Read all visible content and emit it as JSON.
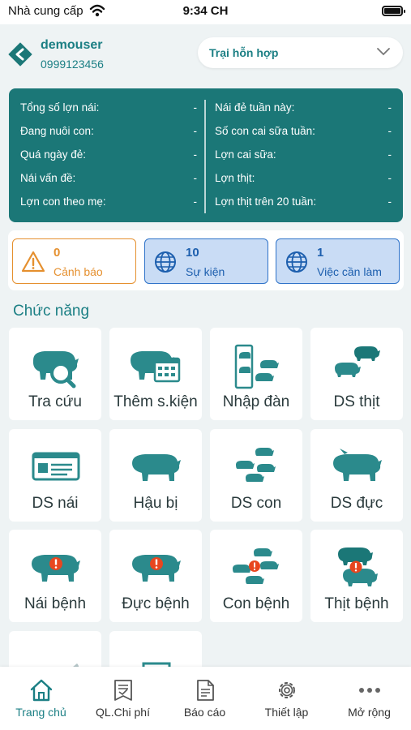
{
  "status_bar": {
    "carrier": "Nhà cung cấp",
    "time": "9:34 CH"
  },
  "header": {
    "username": "demouser",
    "phone": "0999123456",
    "farm": "Trại hỗn hợp"
  },
  "stats": {
    "left": [
      {
        "label": "Tổng số lợn nái:",
        "value": "-"
      },
      {
        "label": "Đang nuôi con:",
        "value": "-"
      },
      {
        "label": "Quá ngày đẻ:",
        "value": "-"
      },
      {
        "label": "Nái vấn đề:",
        "value": "-"
      },
      {
        "label": "Lợn con theo mẹ:",
        "value": "-"
      }
    ],
    "right": [
      {
        "label": "Nái đẻ tuần này:",
        "value": "-"
      },
      {
        "label": "Số con cai sữa tuần:",
        "value": "-"
      },
      {
        "label": "Lợn cai sữa:",
        "value": "-"
      },
      {
        "label": "Lợn thịt:",
        "value": "-"
      },
      {
        "label": "Lợn thịt trên 20 tuần:",
        "value": "-"
      }
    ]
  },
  "summary": {
    "warning": {
      "count": "0",
      "label": "Cảnh báo"
    },
    "events": {
      "count": "10",
      "label": "Sự kiện"
    },
    "todo": {
      "count": "1",
      "label": "Việc cần làm"
    }
  },
  "section_title": "Chức năng",
  "functions": [
    {
      "label": "Tra cứu",
      "icon": "pig-search-icon"
    },
    {
      "label": "Thêm s.kiện",
      "icon": "pig-calendar-icon"
    },
    {
      "label": "Nhập đàn",
      "icon": "pig-import-icon"
    },
    {
      "label": "DS thịt",
      "icon": "pig-group-icon"
    },
    {
      "label": "DS nái",
      "icon": "sow-card-icon"
    },
    {
      "label": "Hậu bị",
      "icon": "gilt-icon"
    },
    {
      "label": "DS con",
      "icon": "piglets-icon"
    },
    {
      "label": "DS đực",
      "icon": "boar-icon"
    },
    {
      "label": "Nái bệnh",
      "icon": "sick-sow-icon"
    },
    {
      "label": "Đực bệnh",
      "icon": "sick-boar-icon"
    },
    {
      "label": "Con bệnh",
      "icon": "sick-piglet-icon"
    },
    {
      "label": "Thịt bệnh",
      "icon": "sick-fattener-icon"
    }
  ],
  "tabs": [
    {
      "label": "Trang chủ",
      "icon": "home-icon",
      "active": true
    },
    {
      "label": "QL.Chi phí",
      "icon": "receipt-icon"
    },
    {
      "label": "Báo cáo",
      "icon": "report-icon"
    },
    {
      "label": "Thiết lập",
      "icon": "settings-icon"
    },
    {
      "label": "Mở rộng",
      "icon": "more-icon"
    }
  ],
  "colors": {
    "primary": "#1b7777",
    "accent": "#1b7f84",
    "warning": "#e5902f",
    "info": "#2f73c9",
    "alert": "#e8461f"
  }
}
